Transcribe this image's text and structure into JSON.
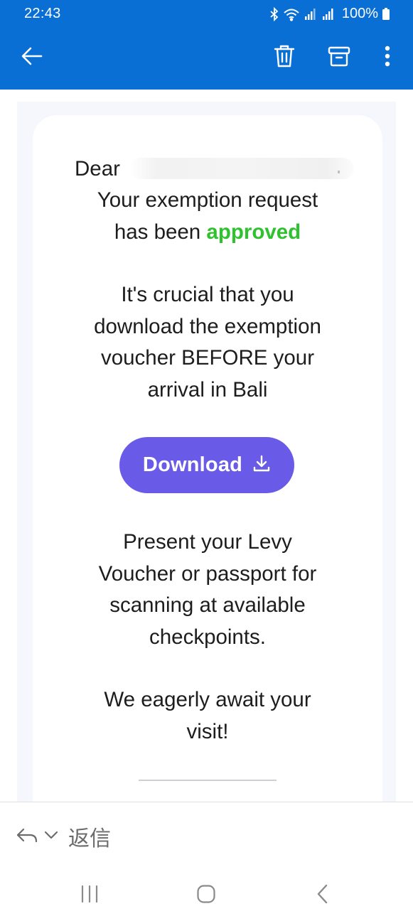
{
  "status_bar": {
    "time": "22:43",
    "battery": "100%",
    "icons": [
      "bluetooth-icon",
      "wifi-icon",
      "signal-icon",
      "signal-icon",
      "battery-icon"
    ]
  },
  "app_bar": {
    "color": "#0a6fd4",
    "icons": [
      "back-arrow-icon",
      "trash-icon",
      "archive-icon",
      "more-vertical-icon"
    ]
  },
  "email": {
    "greeting": "Dear",
    "status_line_1": "Your exemption request",
    "status_line_2_prefix": "has been ",
    "status_word": "approved",
    "status_color": "#2fc22f",
    "paragraph_1": [
      "It's crucial that you",
      "download the exemption",
      "voucher BEFORE your",
      "arrival in Bali"
    ],
    "download_button": {
      "label": "Download",
      "icon": "download-icon",
      "color": "#6a5ae8"
    },
    "paragraph_2": [
      "Present your Levy",
      "Voucher or passport for",
      "scanning at available",
      "checkpoints."
    ],
    "paragraph_3": [
      "We eagerly await your",
      "visit!"
    ]
  },
  "reply_bar": {
    "label": "返信",
    "icons": [
      "reply-icon",
      "chevron-down-icon"
    ]
  },
  "system_nav": {
    "icons": [
      "recent-apps-icon",
      "home-icon",
      "back-icon"
    ]
  }
}
